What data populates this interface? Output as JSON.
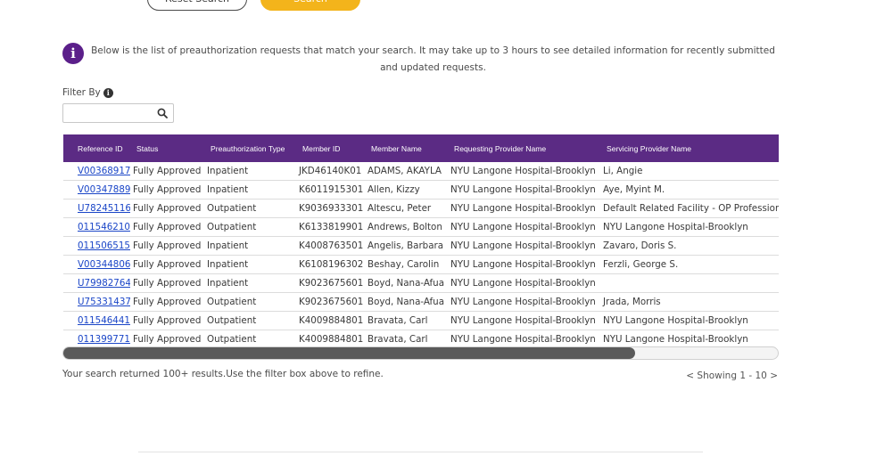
{
  "buttons": {
    "reset_label": "Reset Search",
    "search_label": "Search"
  },
  "info": {
    "icon_glyph": "i",
    "message": "Below is the list of preauthorization requests that match your search. It may take up to 3 hours to see detailed information for recently submitted and updated requests."
  },
  "filter": {
    "label": "Filter By",
    "info_glyph": "i",
    "value": "",
    "placeholder": ""
  },
  "table": {
    "headers": [
      "Reference ID",
      "Status",
      "Preauthorization Type",
      "Member ID",
      "Member Name",
      "Requesting Provider Name",
      "Servicing Provider Name"
    ],
    "rows": [
      [
        "V00368917",
        "Fully Approved",
        "Inpatient",
        "JKD46140K01",
        "ADAMS, AKAYLA",
        "NYU Langone Hospital-Brooklyn",
        "Li, Angie"
      ],
      [
        "V00347889",
        "Fully Approved",
        "Inpatient",
        "K6011915301",
        "Allen, Kizzy",
        "NYU Langone Hospital-Brooklyn",
        "Aye, Myint M."
      ],
      [
        "U78245116",
        "Fully Approved",
        "Outpatient",
        "K9036933301",
        "Altescu, Peter",
        "NYU Langone Hospital-Brooklyn",
        "Default Related Facility - OP Professional"
      ],
      [
        "011546210",
        "Fully Approved",
        "Outpatient",
        "K6133819901",
        "Andrews, Bolton",
        "NYU Langone Hospital-Brooklyn",
        "NYU Langone Hospital-Brooklyn"
      ],
      [
        "011506515",
        "Fully Approved",
        "Inpatient",
        "K4008763501",
        "Angelis, Barbara",
        "NYU Langone Hospital-Brooklyn",
        "Zavaro, Doris S."
      ],
      [
        "V00344806",
        "Fully Approved",
        "Inpatient",
        "K6108196302",
        "Beshay, Carolin",
        "NYU Langone Hospital-Brooklyn",
        "Ferzli, George S."
      ],
      [
        "U79982764",
        "Fully Approved",
        "Inpatient",
        "K9023675601",
        "Boyd, Nana-Afua",
        "NYU Langone Hospital-Brooklyn",
        ""
      ],
      [
        "U75331437",
        "Fully Approved",
        "Outpatient",
        "K9023675601",
        "Boyd, Nana-Afua",
        "NYU Langone Hospital-Brooklyn",
        "Jrada, Morris"
      ],
      [
        "011546441",
        "Fully Approved",
        "Outpatient",
        "K4009884801",
        "Bravata, Carl",
        "NYU Langone Hospital-Brooklyn",
        "NYU Langone Hospital-Brooklyn"
      ],
      [
        "011399771",
        "Fully Approved",
        "Outpatient",
        "K4009884801",
        "Bravata, Carl",
        "NYU Langone Hospital-Brooklyn",
        "NYU Langone Hospital-Brooklyn"
      ]
    ]
  },
  "scrollbar": {
    "thumb_fraction": 0.8
  },
  "footer": {
    "results_text": "Your search returned 100+ results.Use the filter box above to refine.",
    "prev": "<",
    "showing": "Showing 1 - 10",
    "next": ">"
  },
  "colors": {
    "header_bg": "#5b2b84",
    "accent": "#f3b41b",
    "link": "#1a45c7",
    "info_icon": "#5b1f8a"
  }
}
